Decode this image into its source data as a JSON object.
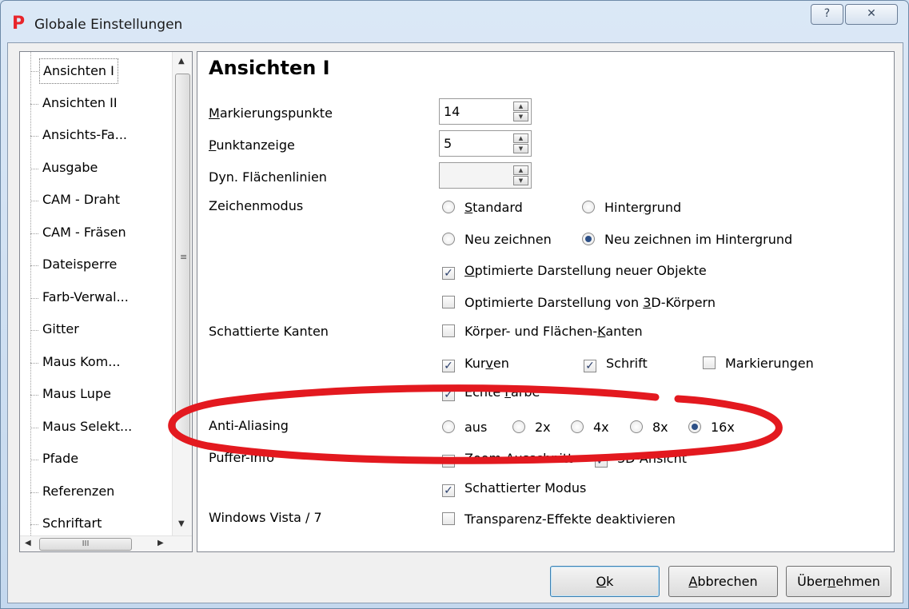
{
  "window": {
    "title": "Globale Einstellungen",
    "app_icon_letter": "P",
    "help_glyph": "?",
    "close_glyph": "✕"
  },
  "tree": {
    "items": [
      "Ansichten I",
      "Ansichten II",
      "Ansichts-Fa...",
      "Ausgabe",
      "CAM - Draht",
      "CAM - Fräsen",
      "Dateisperre",
      "Farb-Verwal...",
      "Gitter",
      "Maus Kom...",
      "Maus Lupe",
      "Maus Selekt...",
      "Pfade",
      "Referenzen",
      "Schriftart"
    ],
    "selected_index": 0,
    "hscroll_glyph": "III"
  },
  "content": {
    "heading": "Ansichten I",
    "fields": {
      "markierungspunkte": {
        "label_u": "M",
        "label_rest": "arkierungspunkte",
        "value": "14"
      },
      "punktanzeige": {
        "label_u": "P",
        "label_rest": "unktanzeige",
        "value": "5"
      },
      "flaechenlinien": {
        "label": "Dyn. Flächenlinien",
        "value": ""
      }
    },
    "zeichenmodus": {
      "label": "Zeichenmodus",
      "standard": {
        "u": "S",
        "rest": "tandard",
        "selected": false
      },
      "hintergrund": {
        "pre": "Hinter",
        "u": "g",
        "rest": "rund",
        "selected": false
      },
      "neu_zeichnen": {
        "label": "Neu zeichnen",
        "selected": false
      },
      "neu_zeichnen_hintergrund": {
        "label": "Neu zeichnen im Hintergrund",
        "selected": true
      },
      "optimierte_neue": {
        "u": "O",
        "rest": "ptimierte Darstellung neuer Objekte",
        "checked": true
      },
      "optimierte_3d": {
        "pre": "Optimierte Darstellung von ",
        "u": "3",
        "rest": "D-Körpern",
        "checked": false
      }
    },
    "schattierte_kanten": {
      "label": "Schattierte Kanten",
      "koerper": {
        "pre": "Körper- und Flächen-",
        "u": "K",
        "rest": "anten",
        "checked": false
      },
      "kurven": {
        "pre": "Kur",
        "u": "v",
        "rest": "en",
        "checked": true
      },
      "schrift": {
        "label": "Schrift",
        "checked": true
      },
      "markierungen": {
        "label": "Markierungen",
        "checked": false
      },
      "echte_farbe": {
        "pre": "Echte ",
        "u": "F",
        "rest": "arbe",
        "checked": true
      }
    },
    "anti_aliasing": {
      "label": "Anti-Aliasing",
      "options": [
        "aus",
        "2x",
        "4x",
        "8x",
        "16x"
      ],
      "selected": "16x"
    },
    "puffer_info": {
      "label": "Puffer-Info",
      "zoom": {
        "label": "Zoom-Ausschnitt",
        "checked": true
      },
      "ansicht3d": {
        "label": "3D-Ansicht",
        "checked": true
      },
      "schattierter": {
        "label": "Schattierter Modus",
        "checked": true
      }
    },
    "windows": {
      "label": "Windows Vista / 7",
      "transparenz": {
        "label": "Transparenz-Effekte deaktivieren",
        "checked": false
      }
    }
  },
  "buttons": {
    "ok": {
      "u": "O",
      "rest": "k"
    },
    "cancel": {
      "u": "A",
      "rest": "bbrechen"
    },
    "apply": {
      "pre": "Über",
      "u": "n",
      "rest": "ehmen"
    }
  },
  "colors": {
    "annotation": "#e3191f",
    "app_icon": "#e8252b"
  }
}
